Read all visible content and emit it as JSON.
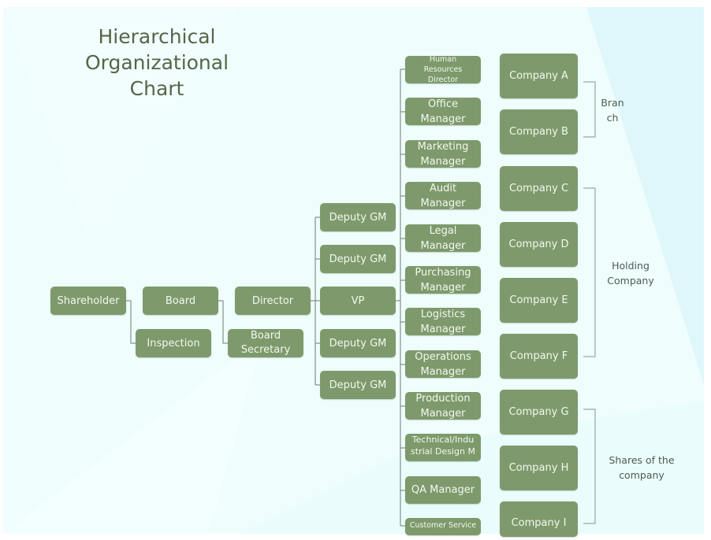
{
  "title": "Hierarchical Organizational Chart",
  "title_lines": [
    "Hierarchical",
    "Organizational",
    "Chart"
  ],
  "colors": {
    "node_fill": "#7e9a6c",
    "node_text": "#f3f7ee",
    "title": "#546748",
    "connector": "#6f7a6f",
    "background": "#effdfd"
  },
  "nodes": {
    "shareholder": "Shareholder",
    "board": "Board",
    "director": "Director",
    "inspection": "Inspection",
    "board_secretary": "Board Secretary",
    "vp": "VP",
    "deputy_gm_1": "Deputy GM",
    "deputy_gm_2": "Deputy GM",
    "deputy_gm_3": "Deputy GM",
    "deputy_gm_4": "Deputy GM"
  },
  "managers": [
    "Human Resources Director",
    "Office Manager",
    "Marketing Manager",
    "Audit Manager",
    "Legal Manager",
    "Purchasing Manager",
    "Logistics Manager",
    "Operations Manager",
    "Production Manager",
    "Technical/Industrial Design Ma...",
    "QA Manager",
    "Customer Service"
  ],
  "companies": [
    "Company A",
    "Company B",
    "Company C",
    "Company D",
    "Company E",
    "Company F",
    "Company G",
    "Company H",
    "Company I"
  ],
  "groups": [
    {
      "label": "Branch",
      "display": "Bran ch",
      "members": [
        "Company A",
        "Company B"
      ]
    },
    {
      "label": "Holding Company",
      "members": [
        "Company C",
        "Company D",
        "Company E",
        "Company F"
      ]
    },
    {
      "label": "Shares of the company",
      "members": [
        "Company G",
        "Company H",
        "Company I"
      ]
    }
  ]
}
